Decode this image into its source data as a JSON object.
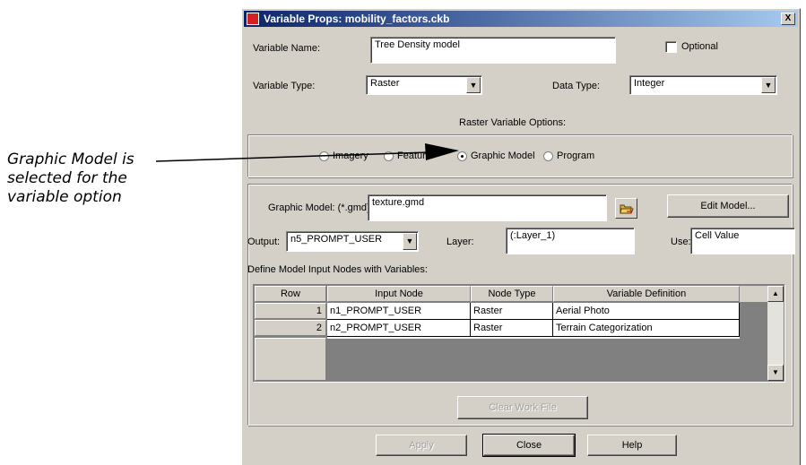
{
  "annotation": {
    "lines": [
      "Graphic Model is",
      "selected for the",
      "variable option"
    ]
  },
  "dialog": {
    "title": "Variable Props:  mobility_factors.ckb",
    "close_glyph": "X",
    "variable_name_label": "Variable Name:",
    "variable_name_value": "Tree Density model",
    "optional_label": "Optional",
    "optional_checked": false,
    "variable_type_label": "Variable Type:",
    "variable_type_value": "Raster",
    "data_type_label": "Data Type:",
    "data_type_value": "Integer",
    "raster_options_label": "Raster Variable Options:",
    "radio_options": [
      {
        "label": "Imagery",
        "selected": false
      },
      {
        "label": "Feature",
        "selected": false
      },
      {
        "label": "Graphic Model",
        "selected": true
      },
      {
        "label": "Program",
        "selected": false
      }
    ],
    "graphic_model_label": "Graphic Model: (*.gmd)",
    "graphic_model_value": "texture.gmd",
    "edit_model_button": "Edit Model...",
    "output_label": "Output:",
    "output_value": "n5_PROMPT_USER",
    "layer_label": "Layer:",
    "layer_value": "(:Layer_1)",
    "use_label": "Use:",
    "use_value": "Cell Value",
    "define_nodes_label": "Define Model Input Nodes with Variables:",
    "table": {
      "columns": [
        "Row",
        "Input Node",
        "Node Type",
        "Variable Definition"
      ],
      "rows": [
        {
          "row": "1",
          "input_node": "n1_PROMPT_USER",
          "node_type": "Raster",
          "variable_definition": "Aerial Photo"
        },
        {
          "row": "2",
          "input_node": "n2_PROMPT_USER",
          "node_type": "Raster",
          "variable_definition": "Terrain Categorization"
        }
      ]
    },
    "clear_work_file_button": "Clear Work File",
    "apply_button": "Apply",
    "close_button": "Close",
    "help_button": "Help"
  }
}
